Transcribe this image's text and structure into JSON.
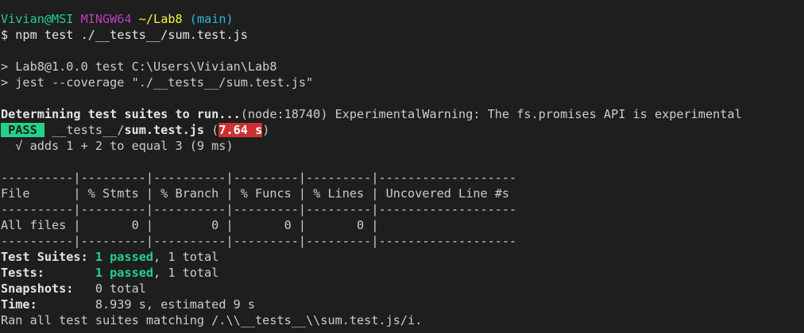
{
  "prompt": {
    "user_host": "Vivian@MSI",
    "env": "MINGW64",
    "path": "~/Lab8",
    "branch": "(main)"
  },
  "command": "$ npm test ./__tests__/sum.test.js",
  "script_lines": [
    "> Lab8@1.0.0 test C:\\Users\\Vivian\\Lab8",
    "> jest --coverage \"./__tests__/sum.test.js\""
  ],
  "determining": {
    "label": "Determining test suites to run...",
    "warning": "(node:18740) ExperimentalWarning: The fs.promises API is experimental"
  },
  "result": {
    "status": " PASS ",
    "dir": "__tests__/",
    "file": "sum.test.js",
    "open_paren": " (",
    "duration": "7.64 s",
    "close_paren": ")",
    "test_line": "  √ adds 1 + 2 to equal 3 (9 ms)"
  },
  "coverage_table": {
    "separator": "----------|---------|----------|---------|---------|-------------------",
    "header": "File      | % Stmts | % Branch | % Funcs | % Lines | Uncovered Line #s ",
    "row": "All files |       0 |        0 |       0 |       0 |                   "
  },
  "summary": {
    "suites_label": "Test Suites: ",
    "suites_passed": "1 passed",
    "suites_rest": ", 1 total",
    "tests_label": "Tests:       ",
    "tests_passed": "1 passed",
    "tests_rest": ", 1 total",
    "snapshots_label": "Snapshots:   ",
    "snapshots_rest": "0 total",
    "time_label": "Time:        ",
    "time_rest": "8.939 s, estimated 9 s",
    "ran": "Ran all test suites matching /.\\\\__tests__\\\\sum.test.js/i."
  },
  "colors": {
    "background": "#1e1e1e",
    "text": "#cccccc",
    "green": "#23d18b",
    "magenta": "#bc3fbc",
    "yellow": "#f5f543",
    "cyan": "#29b8db",
    "red": "#cd3131"
  }
}
